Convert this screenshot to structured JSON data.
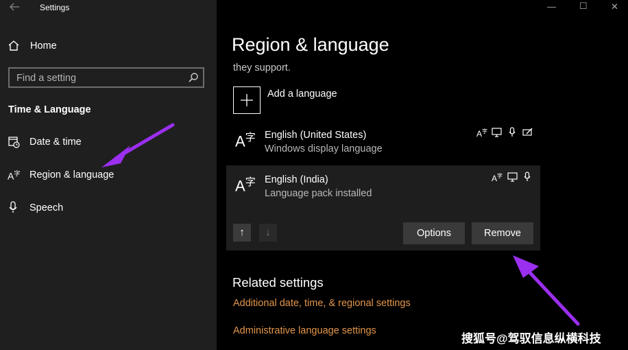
{
  "window": {
    "title": "Settings",
    "back_icon": "back-arrow-icon",
    "minimize_glyph": "—",
    "maximize_glyph": "☐",
    "close_glyph": "✕"
  },
  "sidebar": {
    "home_label": "Home",
    "search_placeholder": "Find a setting",
    "section_title": "Time & Language",
    "items": [
      {
        "label": "Date & time",
        "icon": "calendar-clock-icon"
      },
      {
        "label": "Region & language",
        "icon": "language-icon"
      },
      {
        "label": "Speech",
        "icon": "microphone-icon"
      }
    ]
  },
  "main": {
    "title": "Region & language",
    "clipped_text": "they support.",
    "add_language_label": "Add a language",
    "languages": [
      {
        "name": "English (United States)",
        "status": "Windows display language",
        "features": [
          "language-pack-icon",
          "display-icon",
          "speech-icon",
          "handwriting-icon"
        ]
      },
      {
        "name": "English (India)",
        "status": "Language pack installed",
        "features": [
          "language-pack-icon",
          "display-icon",
          "speech-icon"
        ]
      }
    ],
    "options_label": "Options",
    "remove_label": "Remove",
    "related_title": "Related settings",
    "related_links": [
      "Additional date, time, & regional settings",
      "Administrative language settings"
    ]
  },
  "watermark": "搜狐号@驾驭信息纵横科技",
  "colors": {
    "sidebar_bg": "#1f1f1f",
    "main_bg": "#000000",
    "link": "#e3954a",
    "arrow_annotation": "#9b2ff0"
  }
}
